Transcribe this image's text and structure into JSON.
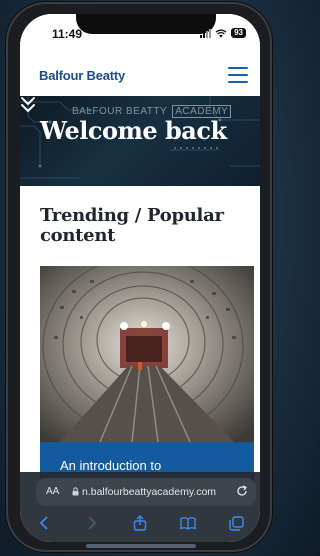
{
  "status_bar": {
    "time": "11:49",
    "battery": "93"
  },
  "header": {
    "logo": "Balfour Beatty"
  },
  "hero": {
    "watermark_left": "BALFOUR BEATTY",
    "watermark_right": "ACADEMY",
    "title": "Welcome back"
  },
  "trending": {
    "heading": "Trending / Popular content",
    "card_caption": "An introduction to"
  },
  "browser": {
    "aa_label": "AA",
    "url": "n.balfourbeattyacademy.com"
  },
  "colors": {
    "brand_blue": "#135b9d",
    "logo_blue": "#1a4f8a"
  }
}
